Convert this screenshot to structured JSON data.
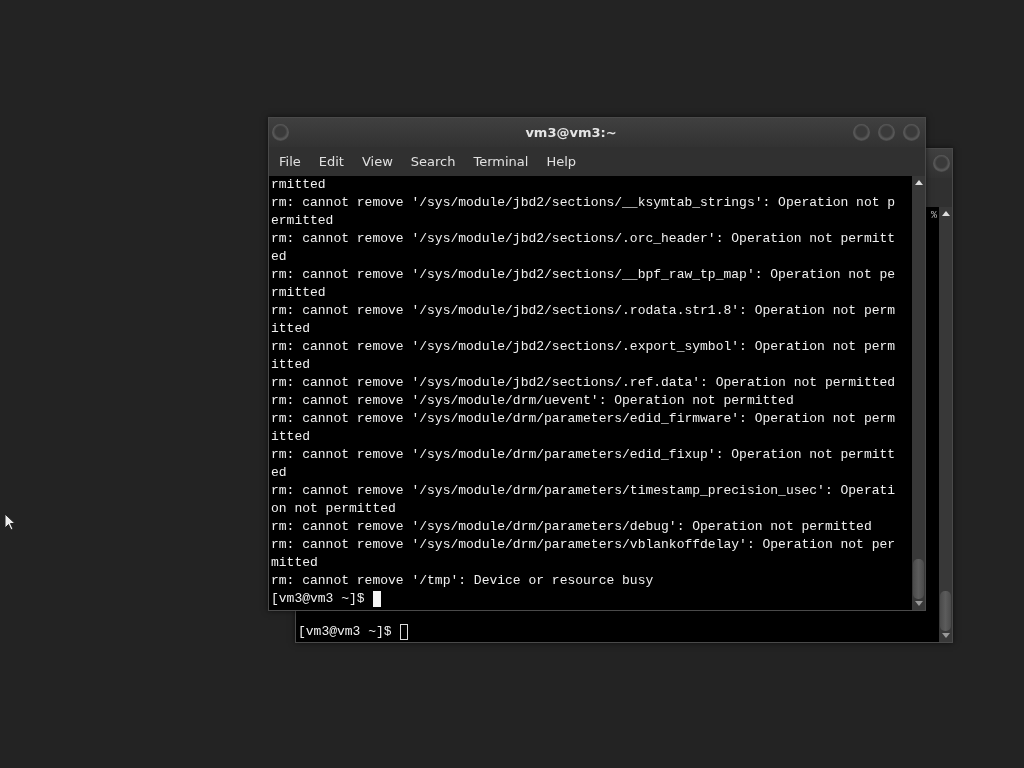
{
  "back_window": {
    "terminal": {
      "fragment": "%",
      "prompt": "[vm3@vm3 ~]$",
      "cursor_filled": false
    }
  },
  "front_window": {
    "title": "vm3@vm3:~",
    "menu": [
      {
        "label": "File"
      },
      {
        "label": "Edit"
      },
      {
        "label": "View"
      },
      {
        "label": "Search"
      },
      {
        "label": "Terminal"
      },
      {
        "label": "Help"
      }
    ],
    "terminal": {
      "lines": [
        "rmitted",
        "rm: cannot remove '/sys/module/jbd2/sections/__ksymtab_strings': Operation not p",
        "ermitted",
        "rm: cannot remove '/sys/module/jbd2/sections/.orc_header': Operation not permitt",
        "ed",
        "rm: cannot remove '/sys/module/jbd2/sections/__bpf_raw_tp_map': Operation not pe",
        "rmitted",
        "rm: cannot remove '/sys/module/jbd2/sections/.rodata.str1.8': Operation not perm",
        "itted",
        "rm: cannot remove '/sys/module/jbd2/sections/.export_symbol': Operation not perm",
        "itted",
        "rm: cannot remove '/sys/module/jbd2/sections/.ref.data': Operation not permitted",
        "rm: cannot remove '/sys/module/drm/uevent': Operation not permitted",
        "rm: cannot remove '/sys/module/drm/parameters/edid_firmware': Operation not perm",
        "itted",
        "rm: cannot remove '/sys/module/drm/parameters/edid_fixup': Operation not permitt",
        "ed",
        "rm: cannot remove '/sys/module/drm/parameters/timestamp_precision_usec': Operati",
        "on not permitted",
        "rm: cannot remove '/sys/module/drm/parameters/debug': Operation not permitted",
        "rm: cannot remove '/sys/module/drm/parameters/vblankoffdelay': Operation not per",
        "mitted",
        "rm: cannot remove '/tmp': Device or resource busy"
      ],
      "prompt": "[vm3@vm3 ~]$",
      "cursor_filled": true
    }
  }
}
